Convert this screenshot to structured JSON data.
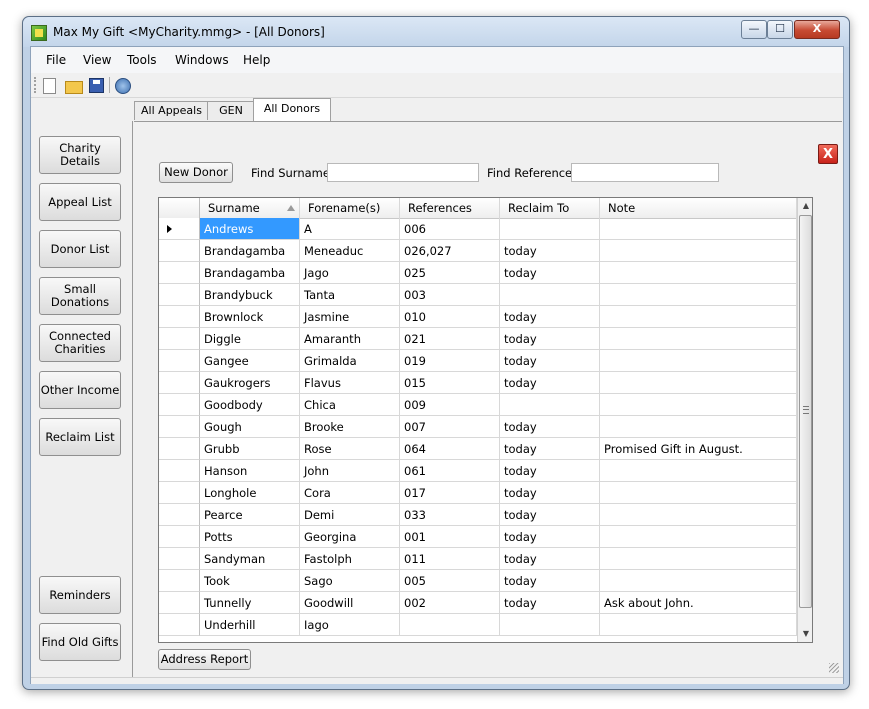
{
  "window": {
    "title": "Max My Gift <MyCharity.mmg>  - [All Donors]",
    "minimize_glyph": "—",
    "maximize_glyph": "☐",
    "close_glyph": "X"
  },
  "menu": [
    "File",
    "View",
    "Tools",
    "Windows",
    "Help"
  ],
  "toolbar": {
    "icons": [
      "new-document-icon",
      "open-folder-icon",
      "save-disk-icon",
      "help-globe-icon"
    ]
  },
  "tabs": [
    {
      "label": "All Appeals",
      "active": false
    },
    {
      "label": "GEN",
      "active": false
    },
    {
      "label": "All Donors",
      "active": true
    }
  ],
  "sidebar": {
    "items": [
      "Charity Details",
      "Appeal List",
      "Donor List",
      "Small\nDonations",
      "Connected\nCharities",
      "Other Income",
      "Reclaim List"
    ],
    "bottom_items": [
      "Reminders",
      "Find Old Gifts"
    ]
  },
  "main": {
    "close_glyph": "X",
    "new_donor_label": "New Donor",
    "find_surname_label": "Find Surname",
    "find_surname_value": "",
    "find_reference_label": "Find Reference",
    "find_reference_value": "",
    "address_report_label": "Address Report"
  },
  "table": {
    "columns": [
      "Surname",
      "Forename(s)",
      "References",
      "Reclaim To",
      "Note"
    ],
    "sorted_column": "Surname",
    "selected_row": 0,
    "rows": [
      [
        "Andrews",
        "A",
        "006",
        "",
        ""
      ],
      [
        "Brandagamba",
        "Meneaduc",
        "026,027",
        "today",
        ""
      ],
      [
        "Brandagamba",
        "Jago",
        "025",
        "today",
        ""
      ],
      [
        "Brandybuck",
        "Tanta",
        "003",
        "",
        ""
      ],
      [
        "Brownlock",
        "Jasmine",
        "010",
        "today",
        ""
      ],
      [
        "Diggle",
        "Amaranth",
        "021",
        "today",
        ""
      ],
      [
        "Gangee",
        "Grimalda",
        "019",
        "today",
        ""
      ],
      [
        "Gaukrogers",
        "Flavus",
        "015",
        "today",
        ""
      ],
      [
        "Goodbody",
        "Chica",
        "009",
        "",
        ""
      ],
      [
        "Gough",
        "Brooke",
        "007",
        "today",
        ""
      ],
      [
        "Grubb",
        "Rose",
        "064",
        "today",
        "Promised Gift in August."
      ],
      [
        "Hanson",
        "John",
        "061",
        "today",
        ""
      ],
      [
        "Longhole",
        "Cora",
        "017",
        "today",
        ""
      ],
      [
        "Pearce",
        "Demi",
        "033",
        "today",
        ""
      ],
      [
        "Potts",
        "Georgina",
        "001",
        "today",
        ""
      ],
      [
        "Sandyman",
        "Fastolph",
        "011",
        "today",
        ""
      ],
      [
        "Took",
        "Sago",
        "005",
        "today",
        ""
      ],
      [
        "Tunnelly",
        "Goodwill",
        "002",
        "today",
        "Ask about John."
      ],
      [
        "Underhill",
        "Iago",
        "",
        "",
        ""
      ]
    ]
  },
  "scrollbar": {
    "up_glyph": "▲",
    "down_glyph": "▼"
  }
}
